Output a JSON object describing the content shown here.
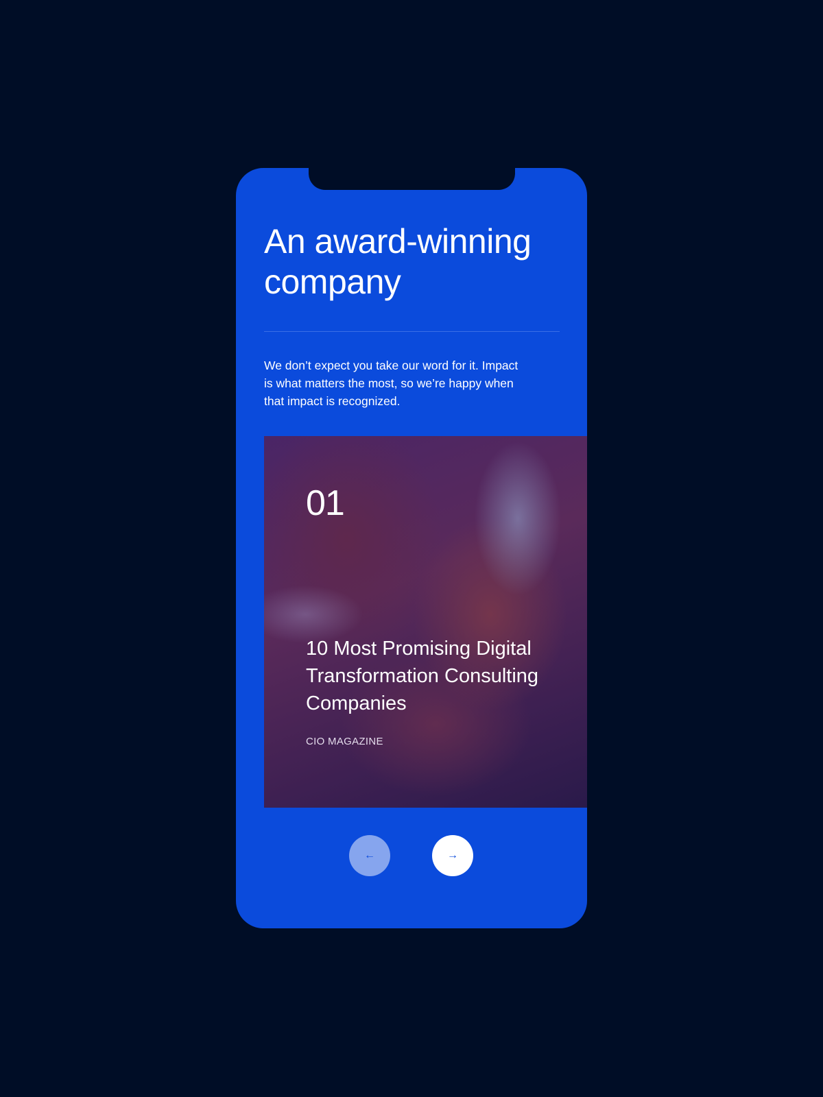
{
  "header": {
    "title": "An award-winning company"
  },
  "intro": "We don’t expect you take our word for it. Impact is what matters the most, so we’re happy when that impact is recognized.",
  "awards": [
    {
      "number": "01",
      "title": "10 Most Promising Digital Transformation Consulting Companies",
      "source": "CIO MAGAZINE"
    }
  ],
  "carousel": {
    "prev_icon": "←",
    "next_icon": "→",
    "prev_icon_name": "arrow-left-icon",
    "next_icon_name": "arrow-right-icon"
  },
  "colors": {
    "background": "#000d26",
    "brand": "#0b4bdc",
    "prev_button": "#86a5ee",
    "next_button": "#ffffff"
  }
}
